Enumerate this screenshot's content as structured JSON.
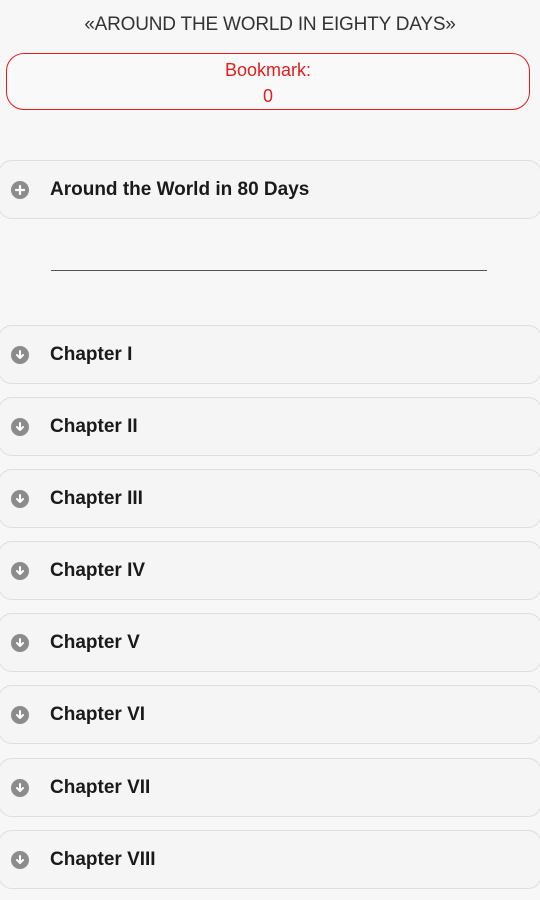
{
  "header": {
    "title": "«AROUND THE WORLD IN EIGHTY DAYS»"
  },
  "bookmark": {
    "label": "Bookmark:",
    "value": "0"
  },
  "book": {
    "label": "Around the World in 80 Days",
    "icon": "plus-circle-icon"
  },
  "chapters": [
    {
      "label": "Chapter I",
      "icon": "arrow-down-circle-icon"
    },
    {
      "label": "Chapter II",
      "icon": "arrow-down-circle-icon"
    },
    {
      "label": "Chapter III",
      "icon": "arrow-down-circle-icon"
    },
    {
      "label": "Chapter IV",
      "icon": "arrow-down-circle-icon"
    },
    {
      "label": "Chapter V",
      "icon": "arrow-down-circle-icon"
    },
    {
      "label": "Chapter VI",
      "icon": "arrow-down-circle-icon"
    },
    {
      "label": "Chapter VII",
      "icon": "arrow-down-circle-icon"
    },
    {
      "label": "Chapter VIII",
      "icon": "arrow-down-circle-icon"
    }
  ],
  "colors": {
    "accent": "#e31c1c",
    "icon": "#8c8c8c",
    "background": "#f7f7f7"
  }
}
